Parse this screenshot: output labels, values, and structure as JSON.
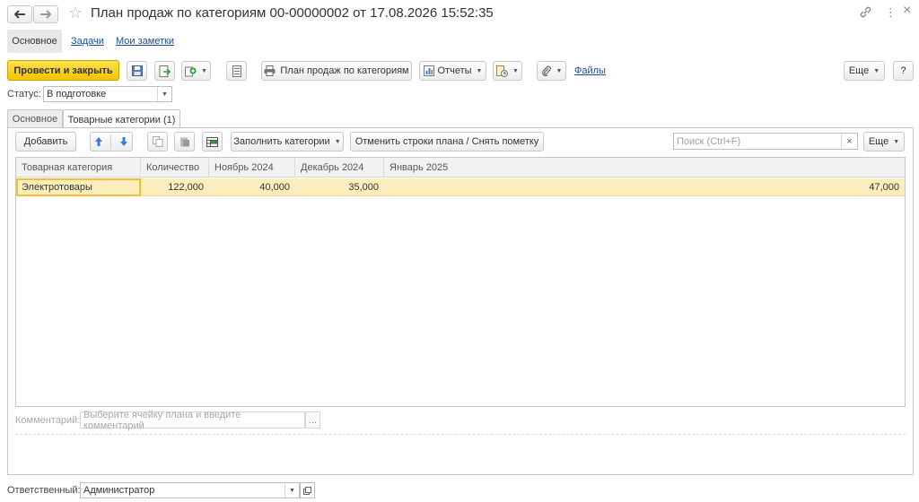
{
  "header": {
    "title": "План продаж по категориям 00-00000002 от 17.08.2026 15:52:35",
    "back_icon": "arrow-left-icon",
    "forward_icon": "arrow-right-icon",
    "star_icon": "star-icon",
    "more_symbol": "⋮",
    "close_symbol": "×"
  },
  "section_tabs": {
    "main": "Основное",
    "tasks": "Задачи",
    "notes": "Мои заметки"
  },
  "toolbar": {
    "post_close": "Провести и закрыть",
    "print_plan": "План продаж по категориям",
    "reports": "Отчеты",
    "files": "Файлы",
    "more": "Еще",
    "help": "?"
  },
  "status": {
    "label": "Статус:",
    "value": "В подготовке"
  },
  "form_tabs": {
    "main": "Основное",
    "categories": "Товарные категории (1)"
  },
  "table_toolbar": {
    "add": "Добавить",
    "fill_categories": "Заполнить категории",
    "cancel_rows": "Отменить строки плана / Снять пометку",
    "search_placeholder": "Поиск (Ctrl+F)",
    "clear": "×",
    "more": "Еще"
  },
  "table": {
    "columns": [
      "Товарная категория",
      "Количество",
      "Ноябрь 2024",
      "Декабрь 2024",
      "Январь 2025"
    ],
    "rows": [
      {
        "category": "Электротовары",
        "quantity": "122,000",
        "nov": "40,000",
        "dec": "35,000",
        "jan": "47,000"
      }
    ]
  },
  "comment": {
    "label": "Комментарий:",
    "placeholder": "Выберите ячейку плана и введите комментарий",
    "dots": "..."
  },
  "responsible": {
    "label": "Ответственный:",
    "value": "Администратор"
  },
  "colors": {
    "accent": "#f4c400",
    "row_highlight": "#fbeebc",
    "link": "#1a4fa0"
  }
}
